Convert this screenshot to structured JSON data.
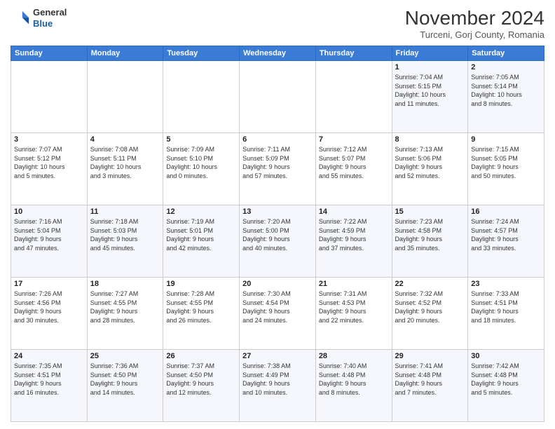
{
  "logo": {
    "line1": "General",
    "line2": "Blue"
  },
  "header": {
    "month": "November 2024",
    "location": "Turceni, Gorj County, Romania"
  },
  "weekdays": [
    "Sunday",
    "Monday",
    "Tuesday",
    "Wednesday",
    "Thursday",
    "Friday",
    "Saturday"
  ],
  "weeks": [
    [
      {
        "day": "",
        "info": ""
      },
      {
        "day": "",
        "info": ""
      },
      {
        "day": "",
        "info": ""
      },
      {
        "day": "",
        "info": ""
      },
      {
        "day": "",
        "info": ""
      },
      {
        "day": "1",
        "info": "Sunrise: 7:04 AM\nSunset: 5:15 PM\nDaylight: 10 hours\nand 11 minutes."
      },
      {
        "day": "2",
        "info": "Sunrise: 7:05 AM\nSunset: 5:14 PM\nDaylight: 10 hours\nand 8 minutes."
      }
    ],
    [
      {
        "day": "3",
        "info": "Sunrise: 7:07 AM\nSunset: 5:12 PM\nDaylight: 10 hours\nand 5 minutes."
      },
      {
        "day": "4",
        "info": "Sunrise: 7:08 AM\nSunset: 5:11 PM\nDaylight: 10 hours\nand 3 minutes."
      },
      {
        "day": "5",
        "info": "Sunrise: 7:09 AM\nSunset: 5:10 PM\nDaylight: 10 hours\nand 0 minutes."
      },
      {
        "day": "6",
        "info": "Sunrise: 7:11 AM\nSunset: 5:09 PM\nDaylight: 9 hours\nand 57 minutes."
      },
      {
        "day": "7",
        "info": "Sunrise: 7:12 AM\nSunset: 5:07 PM\nDaylight: 9 hours\nand 55 minutes."
      },
      {
        "day": "8",
        "info": "Sunrise: 7:13 AM\nSunset: 5:06 PM\nDaylight: 9 hours\nand 52 minutes."
      },
      {
        "day": "9",
        "info": "Sunrise: 7:15 AM\nSunset: 5:05 PM\nDaylight: 9 hours\nand 50 minutes."
      }
    ],
    [
      {
        "day": "10",
        "info": "Sunrise: 7:16 AM\nSunset: 5:04 PM\nDaylight: 9 hours\nand 47 minutes."
      },
      {
        "day": "11",
        "info": "Sunrise: 7:18 AM\nSunset: 5:03 PM\nDaylight: 9 hours\nand 45 minutes."
      },
      {
        "day": "12",
        "info": "Sunrise: 7:19 AM\nSunset: 5:01 PM\nDaylight: 9 hours\nand 42 minutes."
      },
      {
        "day": "13",
        "info": "Sunrise: 7:20 AM\nSunset: 5:00 PM\nDaylight: 9 hours\nand 40 minutes."
      },
      {
        "day": "14",
        "info": "Sunrise: 7:22 AM\nSunset: 4:59 PM\nDaylight: 9 hours\nand 37 minutes."
      },
      {
        "day": "15",
        "info": "Sunrise: 7:23 AM\nSunset: 4:58 PM\nDaylight: 9 hours\nand 35 minutes."
      },
      {
        "day": "16",
        "info": "Sunrise: 7:24 AM\nSunset: 4:57 PM\nDaylight: 9 hours\nand 33 minutes."
      }
    ],
    [
      {
        "day": "17",
        "info": "Sunrise: 7:26 AM\nSunset: 4:56 PM\nDaylight: 9 hours\nand 30 minutes."
      },
      {
        "day": "18",
        "info": "Sunrise: 7:27 AM\nSunset: 4:55 PM\nDaylight: 9 hours\nand 28 minutes."
      },
      {
        "day": "19",
        "info": "Sunrise: 7:28 AM\nSunset: 4:55 PM\nDaylight: 9 hours\nand 26 minutes."
      },
      {
        "day": "20",
        "info": "Sunrise: 7:30 AM\nSunset: 4:54 PM\nDaylight: 9 hours\nand 24 minutes."
      },
      {
        "day": "21",
        "info": "Sunrise: 7:31 AM\nSunset: 4:53 PM\nDaylight: 9 hours\nand 22 minutes."
      },
      {
        "day": "22",
        "info": "Sunrise: 7:32 AM\nSunset: 4:52 PM\nDaylight: 9 hours\nand 20 minutes."
      },
      {
        "day": "23",
        "info": "Sunrise: 7:33 AM\nSunset: 4:51 PM\nDaylight: 9 hours\nand 18 minutes."
      }
    ],
    [
      {
        "day": "24",
        "info": "Sunrise: 7:35 AM\nSunset: 4:51 PM\nDaylight: 9 hours\nand 16 minutes."
      },
      {
        "day": "25",
        "info": "Sunrise: 7:36 AM\nSunset: 4:50 PM\nDaylight: 9 hours\nand 14 minutes."
      },
      {
        "day": "26",
        "info": "Sunrise: 7:37 AM\nSunset: 4:50 PM\nDaylight: 9 hours\nand 12 minutes."
      },
      {
        "day": "27",
        "info": "Sunrise: 7:38 AM\nSunset: 4:49 PM\nDaylight: 9 hours\nand 10 minutes."
      },
      {
        "day": "28",
        "info": "Sunrise: 7:40 AM\nSunset: 4:48 PM\nDaylight: 9 hours\nand 8 minutes."
      },
      {
        "day": "29",
        "info": "Sunrise: 7:41 AM\nSunset: 4:48 PM\nDaylight: 9 hours\nand 7 minutes."
      },
      {
        "day": "30",
        "info": "Sunrise: 7:42 AM\nSunset: 4:48 PM\nDaylight: 9 hours\nand 5 minutes."
      }
    ]
  ]
}
